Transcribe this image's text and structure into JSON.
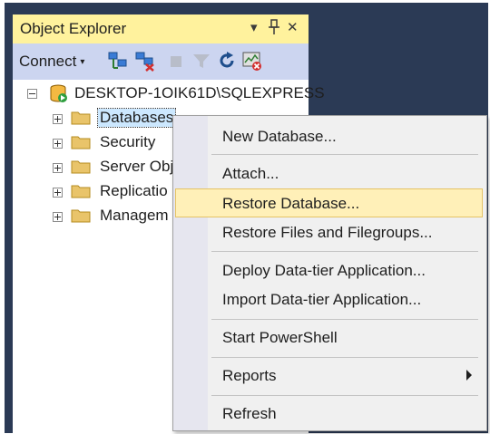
{
  "panel": {
    "title": "Object Explorer",
    "buttons": {
      "dropdown": "▾",
      "pin": "ᛘ",
      "close": "✕"
    }
  },
  "toolbar": {
    "connect_label": "Connect",
    "connect_arrow": "▾",
    "icons": [
      "connect-object-explorer-icon",
      "disconnect-icon",
      "stop-icon",
      "filter-icon",
      "refresh-icon",
      "activity-monitor-icon"
    ]
  },
  "tree": {
    "server": "DESKTOP-1OIK61D\\SQLEXPRESS",
    "nodes": [
      {
        "label": "Databases",
        "selected": true
      },
      {
        "label": "Security"
      },
      {
        "label": "Server Obj"
      },
      {
        "label": "Replicatio"
      },
      {
        "label": "Managem"
      }
    ]
  },
  "context_menu": {
    "items": [
      {
        "label": "New Database..."
      },
      {
        "label": "Attach..."
      },
      {
        "label": "Restore Database...",
        "hover": true
      },
      {
        "label": "Restore Files and Filegroups..."
      },
      {
        "label": "Deploy Data-tier Application..."
      },
      {
        "label": "Import Data-tier Application..."
      },
      {
        "label": "Start PowerShell"
      },
      {
        "label": "Reports",
        "submenu": true
      },
      {
        "label": "Refresh"
      }
    ]
  },
  "colors": {
    "frame": "#2b3a55",
    "titlebar": "#fff29d",
    "toolbar": "#ccd5f0",
    "selection": "#cce8ff",
    "menu_hover": "#fff0b8",
    "folder": "#e9c46a"
  }
}
